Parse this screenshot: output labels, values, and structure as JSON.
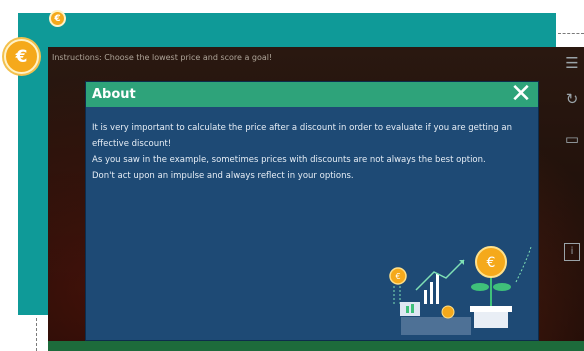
{
  "game": {
    "instructions": "Instructions: Choose the lowest price and score a goal!"
  },
  "coins": {
    "symbol": "€"
  },
  "toolbar": {
    "menu_icon": "menu-icon",
    "refresh_icon": "refresh-icon",
    "chat_icon": "chat-icon",
    "info_label": "i"
  },
  "modal": {
    "title": "About",
    "close_label": "✕",
    "paragraphs": [
      "It is very important to calculate the price after a discount in order to evaluate if you are getting an effective discount!",
      "As you saw in the example, sometimes prices with discounts are not always the best option.",
      "Don't act upon an impulse and always reflect in your options."
    ]
  },
  "colors": {
    "teal": "#0f9a98",
    "modal_bg": "#1e4a75",
    "modal_header": "#2ea37a",
    "coin": "#f5a91b",
    "accent_green": "#3fc07a"
  }
}
